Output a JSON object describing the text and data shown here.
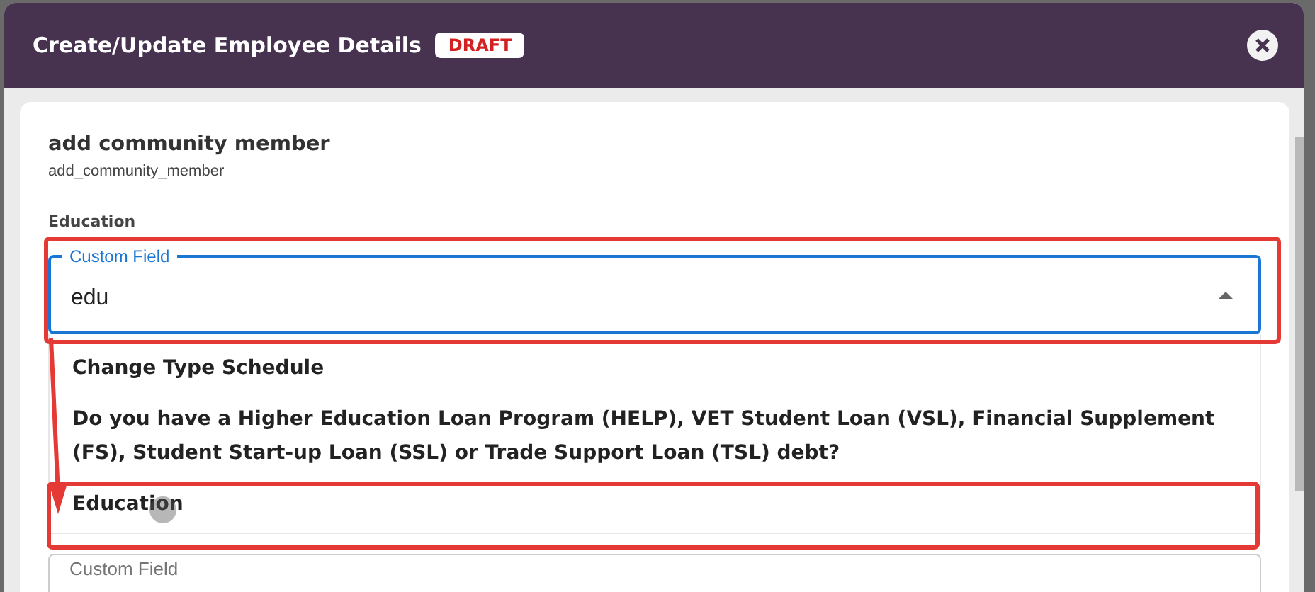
{
  "dialog": {
    "title": "Create/Update Employee Details",
    "badge": "DRAFT"
  },
  "section": {
    "title": "add community member",
    "subtitle": "add_community_member"
  },
  "field_label": "Education",
  "custom_field": {
    "label": "Custom Field",
    "value": "edu",
    "expanded": true
  },
  "options": [
    {
      "label": "Change Type Schedule"
    },
    {
      "label": "Do you have a Higher Education Loan Program (HELP), VET Student Loan (VSL), Financial Supplement (FS), Student Start-up Loan (SSL) or Trade Support Loan (TSL) debt?"
    },
    {
      "label": "Education"
    }
  ],
  "next_field": {
    "placeholder": "Custom Field"
  }
}
